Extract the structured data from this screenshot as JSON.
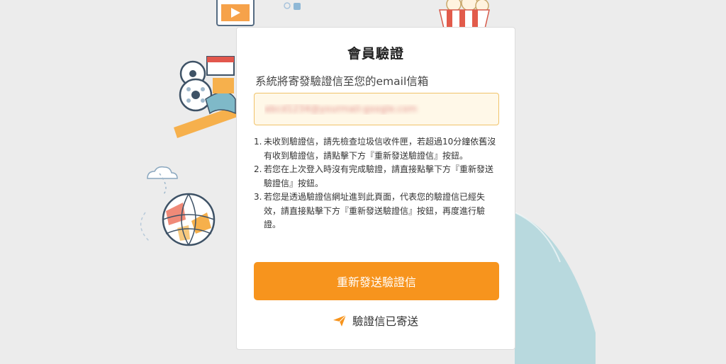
{
  "card": {
    "title": "會員驗證",
    "subtitle": "系統將寄發驗證信至您的email信箱",
    "email_value": "abcd1234@yourmail-google.com"
  },
  "notes": [
    {
      "num": "1.",
      "text": "未收到驗證信，請先檢查垃圾信收件匣，若超過10分鐘依舊沒有收到驗證信，請點擊下方『重新發送驗證信』按鈕。"
    },
    {
      "num": "2.",
      "text": "若您在上次登入時沒有完成驗證，請直接點擊下方『重新發送驗證信』按鈕。"
    },
    {
      "num": "3.",
      "text": "若您是透過驗證信網址進到此頁面，代表您的驗證信已經失效，請直接點擊下方『重新發送驗證信』按鈕，再度進行驗證。"
    }
  ],
  "resend_button_label": "重新發送驗證信",
  "sent_status": "驗證信已寄送",
  "icons": {
    "send": "paper-plane-icon"
  },
  "colors": {
    "accent": "#f7941d",
    "field_border": "#f0c36a",
    "field_bg": "#fff8e8"
  }
}
